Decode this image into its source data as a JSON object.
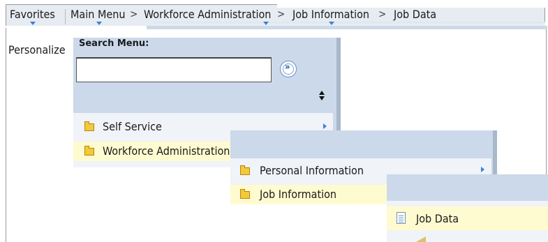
{
  "breadcrumb": {
    "favorites": "Favorites",
    "main_menu": "Main Menu",
    "sep": ">",
    "workforce_admin": "Workforce Administration",
    "job_information": "Job Information",
    "job_data": "Job Data"
  },
  "personalize": "Personalize",
  "search": {
    "label": "Search Menu:",
    "value": "",
    "placeholder": ""
  },
  "menu_level_1": [
    {
      "label": "Self Service",
      "icon": "folder-icon",
      "has_submenu": true
    },
    {
      "label": "Workforce Administration",
      "icon": "folder-icon",
      "highlighted": true
    }
  ],
  "menu_level_2": [
    {
      "label": "Personal Information",
      "icon": "folder-icon",
      "has_submenu": true
    },
    {
      "label": "Job Information",
      "icon": "folder-icon",
      "highlighted": true
    }
  ],
  "menu_level_3": [
    {
      "label": "Job Data",
      "icon": "document-icon",
      "highlighted": true
    }
  ],
  "colors": {
    "panel": "#cbd9ea",
    "highlight": "#fffbd0",
    "arrow": "#3d7fd6"
  }
}
